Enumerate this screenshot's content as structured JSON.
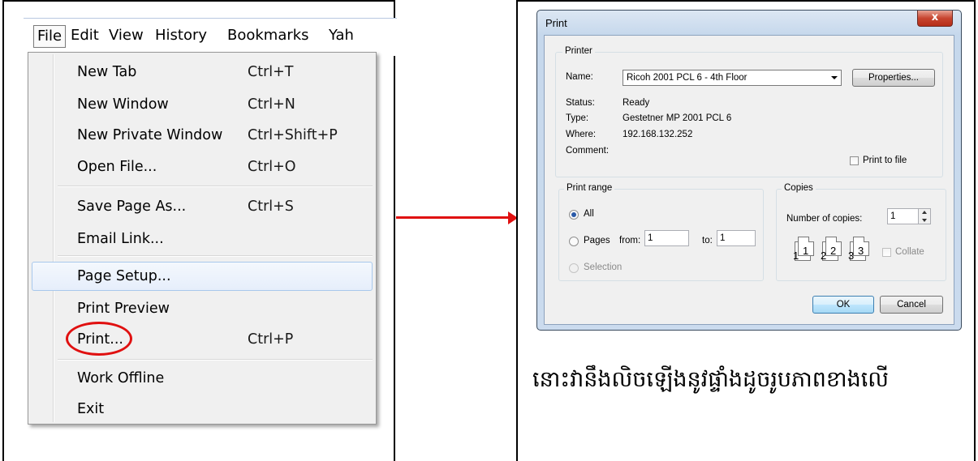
{
  "menubar": {
    "items": [
      "File",
      "Edit",
      "View",
      "History",
      "Bookmarks",
      "Yah"
    ]
  },
  "file_menu": {
    "items": [
      {
        "label": "New Tab",
        "shortcut": "Ctrl+T"
      },
      {
        "label": "New Window",
        "shortcut": "Ctrl+N"
      },
      {
        "label": "New Private Window",
        "shortcut": "Ctrl+Shift+P"
      },
      {
        "label": "Open File...",
        "shortcut": "Ctrl+O"
      },
      {
        "label": "Save Page As...",
        "shortcut": "Ctrl+S"
      },
      {
        "label": "Email Link...",
        "shortcut": ""
      },
      {
        "label": "Page Setup...",
        "shortcut": ""
      },
      {
        "label": "Print Preview",
        "shortcut": ""
      },
      {
        "label": "Print...",
        "shortcut": "Ctrl+P"
      },
      {
        "label": "Work Offline",
        "shortcut": ""
      },
      {
        "label": "Exit",
        "shortcut": ""
      }
    ],
    "highlighted_item": "Page Setup...",
    "circled_item": "Print..."
  },
  "print_dialog": {
    "title": "Print",
    "close_label": "x",
    "printer_group": {
      "legend": "Printer",
      "name_label": "Name:",
      "name_value": "Ricoh 2001 PCL 6 - 4th Floor",
      "properties_button": "Properties...",
      "status_label": "Status:",
      "status_value": "Ready",
      "type_label": "Type:",
      "type_value": "Gestetner MP 2001 PCL 6",
      "where_label": "Where:",
      "where_value": "192.168.132.252",
      "comment_label": "Comment:",
      "print_to_file_label": "Print to file"
    },
    "range_group": {
      "legend": "Print range",
      "all_label": "All",
      "pages_label": "Pages",
      "from_label": "from:",
      "from_value": "1",
      "to_label": "to:",
      "to_value": "1",
      "selection_label": "Selection"
    },
    "copies_group": {
      "legend": "Copies",
      "number_label": "Number of copies:",
      "number_value": "1",
      "collate_label": "Collate",
      "collate_pages": [
        "1",
        "1",
        "2",
        "2",
        "3",
        "3"
      ]
    },
    "ok_button": "OK",
    "cancel_button": "Cancel"
  },
  "caption": "នោះវានឹងលិចឡើងនូវផ្ទាំងដូចរូបភាពខាងលើ",
  "colors": {
    "arrow": "#e01010",
    "highlight": "#a8c8ec",
    "close_button": "#c7452f"
  }
}
